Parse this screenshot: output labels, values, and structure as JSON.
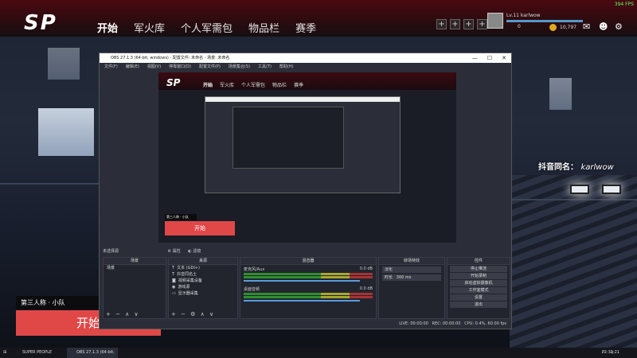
{
  "game": {
    "logo": "SP",
    "nav": [
      "开始",
      "军火库",
      "个人军需包",
      "物品栏",
      "赛季"
    ],
    "fps": "394 FPS",
    "level": "Lv.11",
    "username": "karlwow",
    "stat_left": "0",
    "coins": "10,797",
    "squad_label": "第三人称 · 小队",
    "start_label": "开始",
    "overlay_name": "抖音同名：",
    "overlay_handle": "karlwow"
  },
  "obs": {
    "title": "OBS 27.1.3 (64-bit, windows) - 配置文件: 未命名 - 场景: 未命名",
    "menu": [
      "文件(F)",
      "编辑(E)",
      "视图(V)",
      "停靠窗口(D)",
      "配置文件(P)",
      "场景集合(S)",
      "工具(T)",
      "帮助(H)"
    ],
    "preview": {
      "logo": "SP",
      "nav": [
        "开始",
        "军火库",
        "个人军需包",
        "物品栏",
        "赛季"
      ],
      "squad_label": "第三人称 · 小队",
      "start_label": "开始"
    },
    "no_source": "未选择源",
    "props_label": "属性",
    "filters_label": "滤镜",
    "docks": {
      "scenes": {
        "title": "场景",
        "items": [
          "场景"
        ]
      },
      "sources": {
        "title": "来源",
        "items": [
          "文本 (GDI+)",
          "抖音同名土",
          "视频采集设备",
          "游戏源",
          "显示器采集"
        ]
      },
      "mixer": {
        "title": "混音器",
        "channels": [
          {
            "name": "麦克风/Aux",
            "db": "0.0 dB"
          },
          {
            "name": "桌面音频",
            "db": "0.0 dB"
          }
        ]
      },
      "transitions": {
        "title": "转场特效",
        "type": "淡化",
        "duration_label": "时长",
        "duration": "300 ms"
      },
      "controls": {
        "title": "控件",
        "buttons": [
          "停止推流",
          "开始录制",
          "启动虚拟摄像机",
          "工作室模式",
          "设置",
          "退出"
        ]
      }
    },
    "status": {
      "live": "LIVE: 00:00:00",
      "rec": "REC: 00:00:00",
      "cpu": "CPU: 0.4%, 60.00 fps"
    }
  },
  "taskbar": {
    "apps": [
      "SUPER PEOPLE",
      "OBS 27.1.3 (64-bit, ..."
    ],
    "time": "22:31:21"
  }
}
